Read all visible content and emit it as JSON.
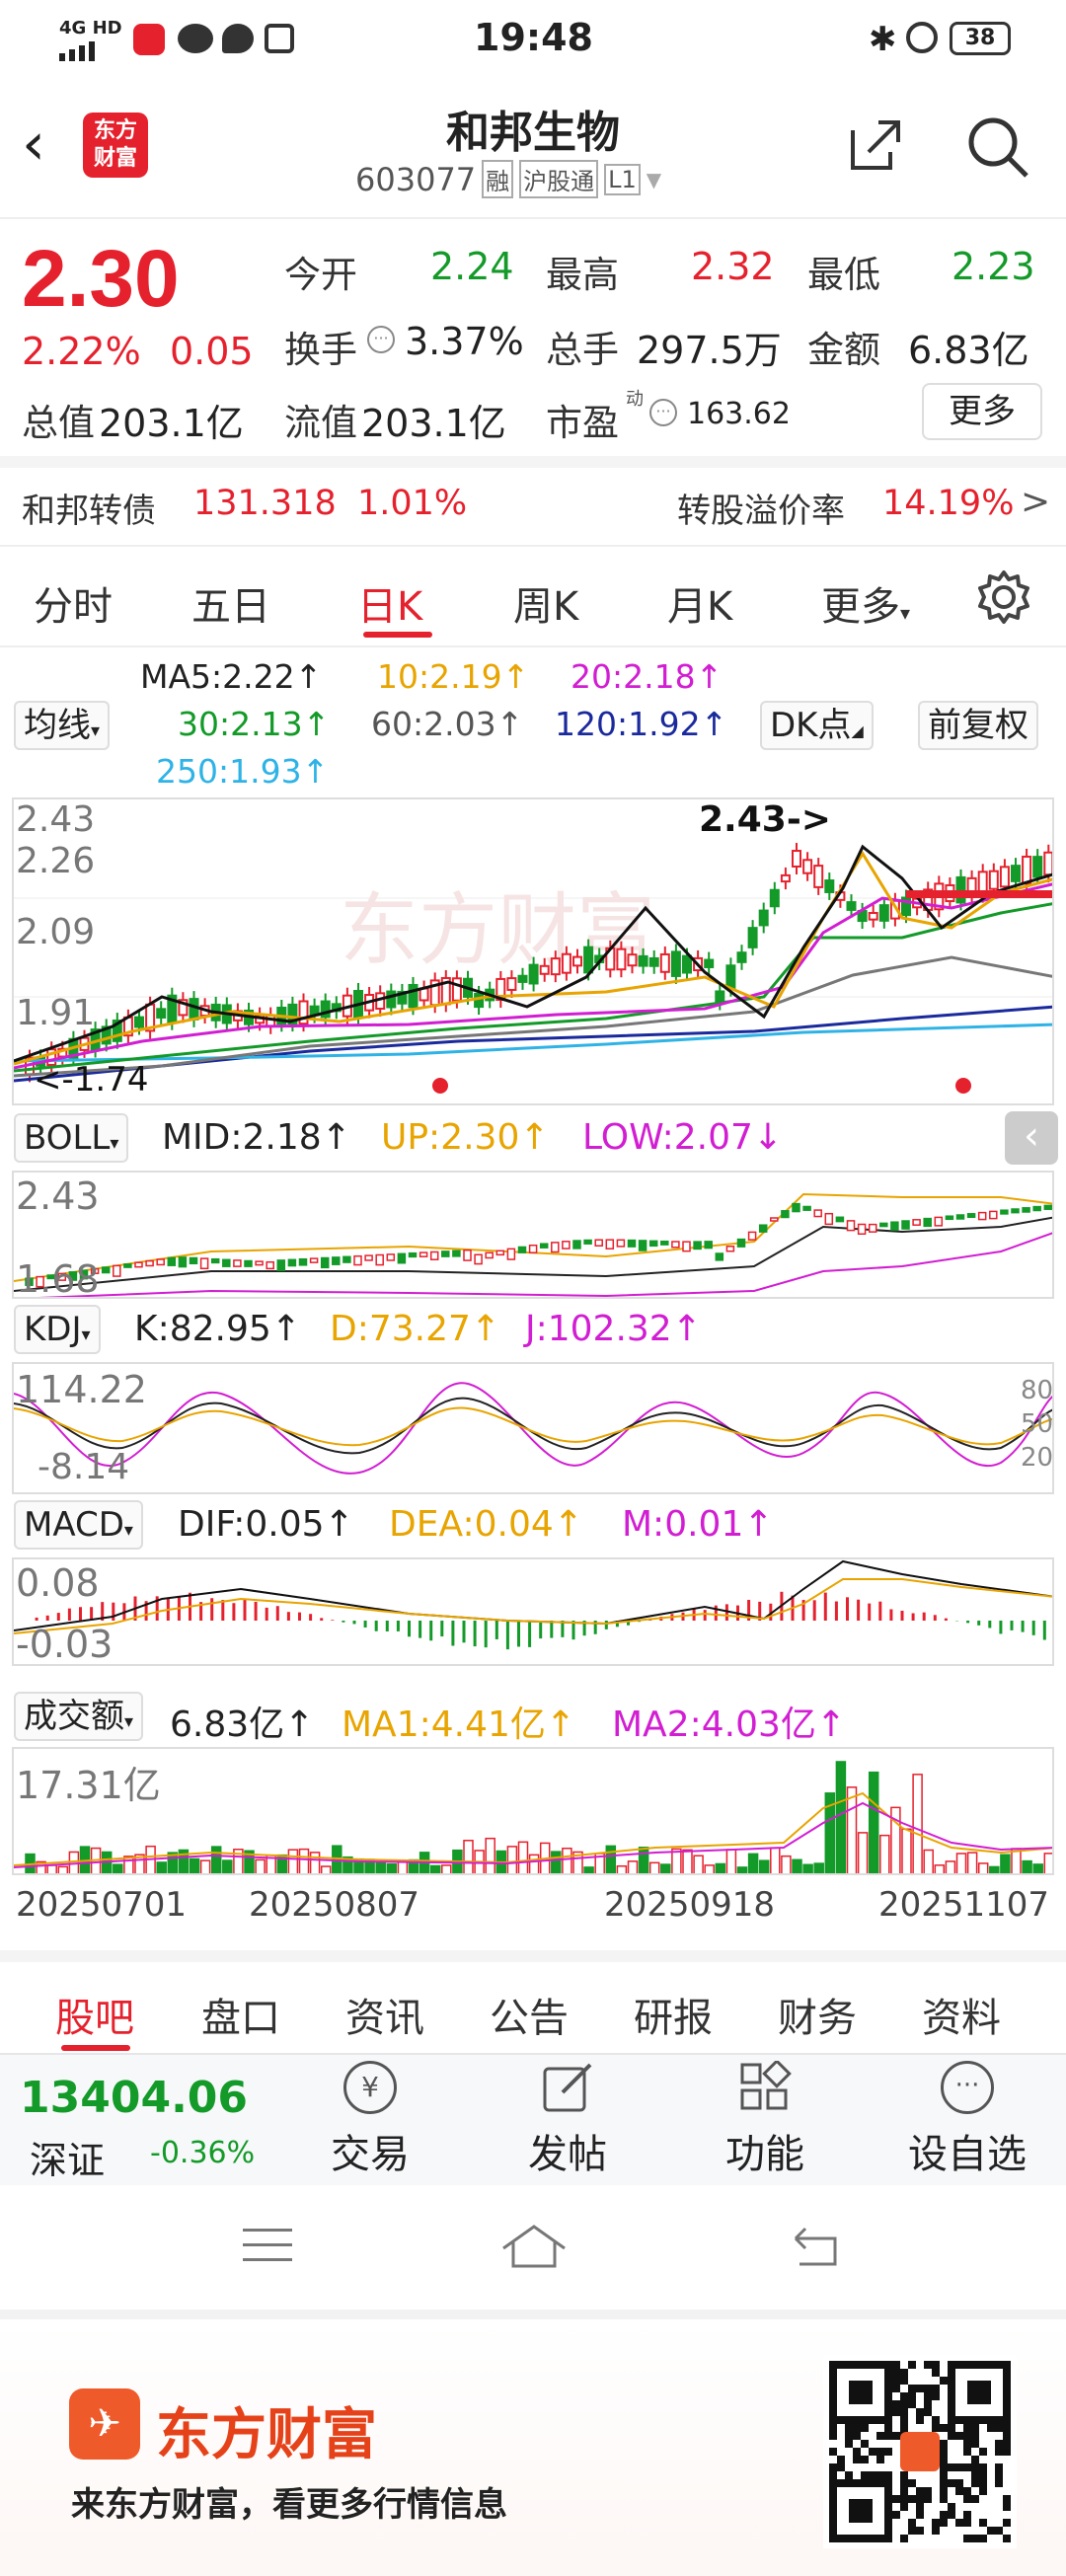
{
  "status_bar": {
    "network": "4G HD",
    "time": "19:48",
    "battery": "38"
  },
  "header": {
    "logo_line1": "东方",
    "logo_line2": "财富",
    "stock_name": "和邦生物",
    "stock_code": "603077",
    "badges": [
      "融",
      "沪股通",
      "L1"
    ]
  },
  "quote": {
    "price": "2.30",
    "change_pct": "2.22%",
    "change": "0.05",
    "open_label": "今开",
    "open": "2.24",
    "high_label": "最高",
    "high": "2.32",
    "low_label": "最低",
    "low": "2.23",
    "turnover_label": "换手",
    "turnover": "3.37%",
    "volume_label": "总手",
    "volume": "297.5万",
    "amount_label": "金额",
    "amount": "6.83亿",
    "mktcap_label": "总值",
    "mktcap": "203.1亿",
    "float_label": "流值",
    "float": "203.1亿",
    "pe_label": "市盈",
    "pe_sup": "动",
    "pe": "163.62",
    "more": "更多"
  },
  "bond": {
    "name": "和邦转债",
    "price": "131.318",
    "pct": "1.01%",
    "premium_label": "转股溢价率",
    "premium": "14.19%",
    "arrow": ">"
  },
  "tabs": [
    "分时",
    "五日",
    "日K",
    "周K",
    "月K",
    "更多"
  ],
  "active_tab": "日K",
  "ma": {
    "selector": "均线",
    "ma5": "MA5:2.22↑",
    "ma10": "10:2.19↑",
    "ma20": "20:2.18↑",
    "ma30": "30:2.13↑",
    "ma60": "60:2.03↑",
    "ma120": "120:1.92↑",
    "ma250": "250:1.93↑",
    "dk": "DK点",
    "fq": "前复权"
  },
  "kline": {
    "y_labels": [
      "2.43",
      "2.26",
      "2.09",
      "1.91"
    ],
    "low_marker": "1.74",
    "high_marker": "2.43->"
  },
  "boll": {
    "selector": "BOLL",
    "mid": "MID:2.18↑",
    "up": "UP:2.30↑",
    "low": "LOW:2.07↓",
    "y_labels": [
      "2.43",
      "1.68"
    ]
  },
  "kdj": {
    "selector": "KDJ",
    "k": "K:82.95↑",
    "d": "D:73.27↑",
    "j": "J:102.32↑",
    "y_labels": [
      "114.22",
      "-8.14"
    ],
    "levels": [
      "80",
      "50",
      "20"
    ]
  },
  "macd": {
    "selector": "MACD",
    "dif": "DIF:0.05↑",
    "dea": "DEA:0.04↑",
    "m": "M:0.01↑",
    "y_labels": [
      "0.08",
      "-0.03"
    ]
  },
  "vol": {
    "selector": "成交额",
    "val": "6.83亿↑",
    "ma1": "MA1:4.41亿↑",
    "ma2": "MA2:4.03亿↑",
    "y_label": "17.31亿"
  },
  "dates": [
    "20250701",
    "20250807",
    "20250918",
    "20251107"
  ],
  "bottom_tabs": [
    "股吧",
    "盘口",
    "资讯",
    "公告",
    "研报",
    "财务",
    "资料"
  ],
  "index": {
    "value": "13404.06",
    "name": "深证",
    "pct": "-0.36%"
  },
  "actions": [
    "交易",
    "发帖",
    "功能",
    "设自选"
  ],
  "footer": {
    "brand": "东方财富",
    "slogan": "来东方财富，看更多行情信息"
  },
  "colors": {
    "up": "#e5212d",
    "down": "#139a28",
    "ma10": "#e8a400",
    "ma20": "#d21ed2",
    "ma120": "#1a2a9c",
    "ma250": "#2fb3e6"
  }
}
